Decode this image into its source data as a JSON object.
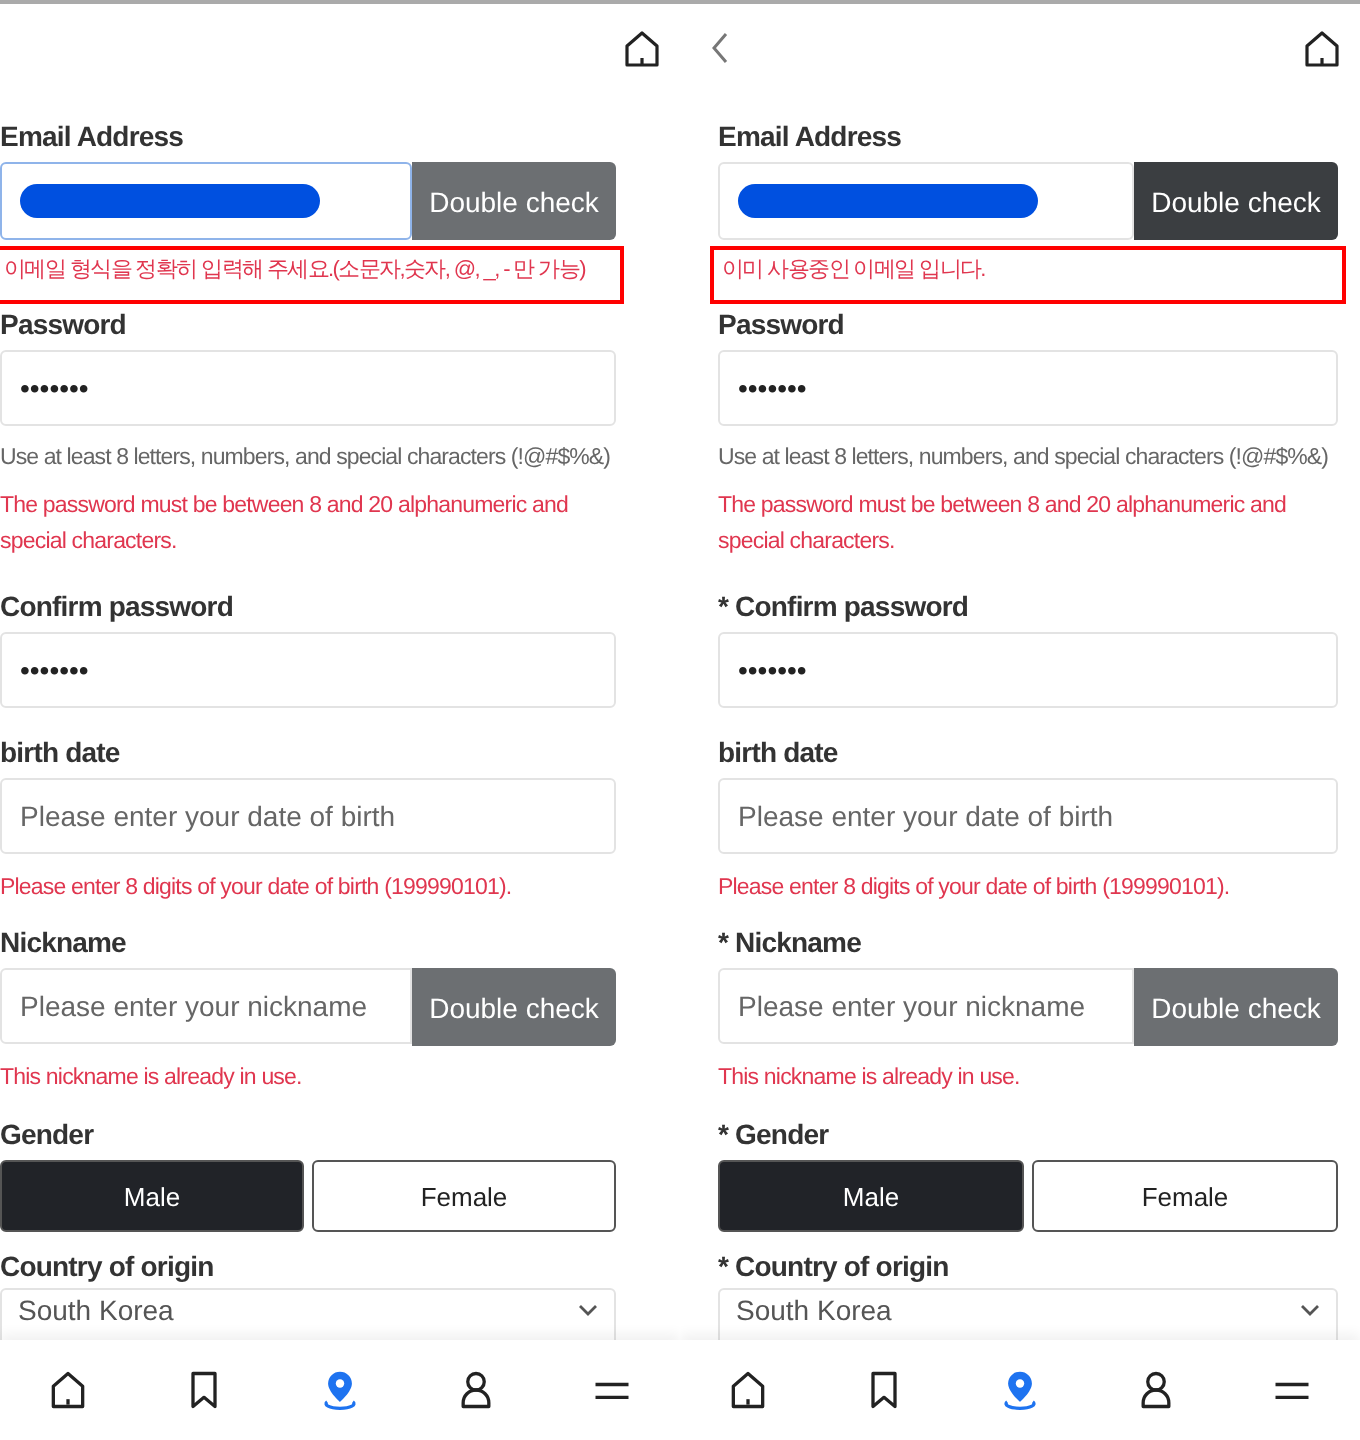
{
  "panels": [
    {
      "email": {
        "label": "Email Address",
        "redacted": true,
        "focused": true,
        "button": {
          "label": "Double check",
          "active": false
        },
        "error": "이메일 형식을 정확히 입력해 주세요.(소문자,숫자, @, _, - 만 가능)",
        "highlighted": true
      },
      "password": {
        "label": "Password",
        "value": "•••••••",
        "hint": "Use at least 8 letters, numbers, and special characters (!@#$%&)",
        "error": "The password must be between 8 and 20 alphanumeric and special characters."
      },
      "confirm": {
        "label": "Confirm password",
        "value": "•••••••"
      },
      "birth": {
        "label": "birth date",
        "placeholder": "Please enter your date of birth",
        "error": "Please enter 8 digits of your date of birth (199990101)."
      },
      "nickname": {
        "label": "Nickname",
        "placeholder": "Please enter your nickname",
        "button": {
          "label": "Double check",
          "active": false
        },
        "error": "This nickname is already in use."
      },
      "gender": {
        "label": "Gender",
        "options": [
          {
            "label": "Male",
            "selected": true
          },
          {
            "label": "Female",
            "selected": false
          }
        ]
      },
      "country": {
        "label": "Country of origin",
        "value": "South Korea"
      },
      "nav": [
        {
          "kind": "home",
          "selected": false
        },
        {
          "kind": "bookmark",
          "selected": false
        },
        {
          "kind": "pin",
          "selected": true
        },
        {
          "kind": "person",
          "selected": false
        },
        {
          "kind": "menu",
          "selected": false
        }
      ]
    },
    {
      "has_back": true,
      "email": {
        "label": "Email Address",
        "redacted": true,
        "focused": false,
        "button": {
          "label": "Double check",
          "active": true
        },
        "error": "이미 사용중인 이메일 입니다.",
        "highlighted": true
      },
      "password": {
        "label": "Password",
        "value": "•••••••",
        "hint": "Use at least 8 letters, numbers, and special characters (!@#$%&)",
        "error": "The password must be between 8 and 20 alphanumeric and special characters."
      },
      "confirm": {
        "label": "* Confirm password",
        "value": "•••••••"
      },
      "birth": {
        "label": "birth date",
        "placeholder": "Please enter your date of birth",
        "error": "Please enter 8 digits of your date of birth (199990101)."
      },
      "nickname": {
        "label": "* Nickname",
        "placeholder": "Please enter your nickname",
        "button": {
          "label": "Double check",
          "active": false
        },
        "error": "This nickname is already in use."
      },
      "gender": {
        "label": "* Gender",
        "options": [
          {
            "label": "Male",
            "selected": true
          },
          {
            "label": "Female",
            "selected": false
          }
        ]
      },
      "country": {
        "label": "* Country of origin",
        "value": "South Korea"
      },
      "nav": [
        {
          "kind": "home",
          "selected": false
        },
        {
          "kind": "bookmark",
          "selected": false
        },
        {
          "kind": "pin",
          "selected": true
        },
        {
          "kind": "person",
          "selected": false
        },
        {
          "kind": "menu",
          "selected": false
        }
      ]
    }
  ]
}
